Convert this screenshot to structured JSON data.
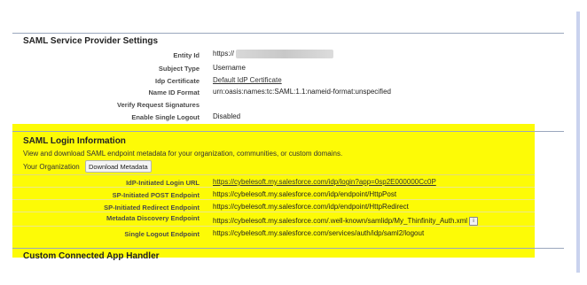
{
  "sp_settings": {
    "title": "SAML Service Provider Settings",
    "rows": [
      {
        "label": "Entity Id",
        "value": "https://"
      },
      {
        "label": "Subject Type",
        "value": "Username"
      },
      {
        "label": "Idp Certificate",
        "value": "Default IdP Certificate"
      },
      {
        "label": "Name ID Format",
        "value": "urn:oasis:names:tc:SAML:1.1:nameid-format:unspecified"
      },
      {
        "label": "Verify Request Signatures",
        "value": ""
      },
      {
        "label": "Enable Single Logout",
        "value": "Disabled"
      }
    ]
  },
  "login_info": {
    "title": "SAML Login Information",
    "intro": "View and download SAML endpoint metadata for your organization, communities, or custom domains.",
    "org_label": "Your Organization",
    "download_label": "Download Metadata",
    "rows": [
      {
        "label": "IdP-Initiated Login URL",
        "value": "https://cybelesoft.my.salesforce.com/idp/login?app=0sp2E000000Cc0P"
      },
      {
        "label": "SP-Initiated POST Endpoint",
        "value": "https://cybelesoft.my.salesforce.com/idp/endpoint/HttpPost"
      },
      {
        "label": "SP-Initiated Redirect Endpoint",
        "value": "https://cybelesoft.my.salesforce.com/idp/endpoint/HttpRedirect"
      },
      {
        "label": "Metadata Discovery Endpoint",
        "value": "https://cybelesoft.my.salesforce.com/.well-known/samlidp/My_Thinfinity_Auth.xml"
      },
      {
        "label": "Single Logout Endpoint",
        "value": "https://cybelesoft.my.salesforce.com/services/auth/idp/saml2/logout"
      }
    ],
    "info_icon_glyph": "i"
  },
  "connected_app": {
    "title": "Custom Connected App Handler"
  },
  "colors": {
    "highlight": "#fdfb06",
    "rule": "#9aa7bd"
  }
}
